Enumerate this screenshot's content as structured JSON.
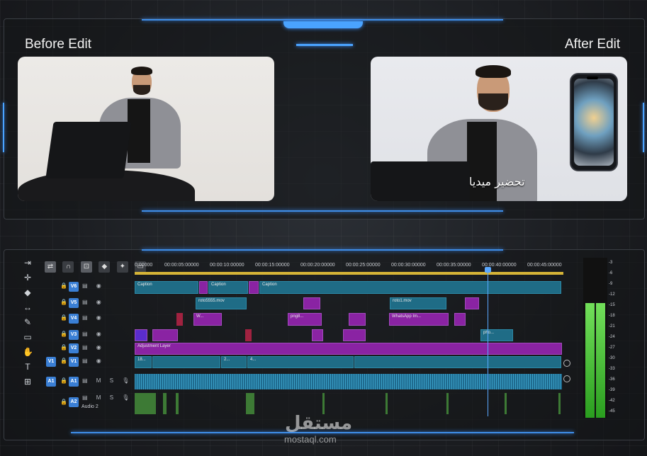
{
  "labels": {
    "before": "Before Edit",
    "after": "After Edit"
  },
  "video_after": {
    "caption": "تحضير ميديا"
  },
  "timeline": {
    "ruler_ticks": [
      "0:00000",
      "00:00:05:00000",
      "00:00:10:00000",
      "00:00:15:00000",
      "00:00:20:00000",
      "00:00:25:00000",
      "00:00:30:00000",
      "00:00:35:00000",
      "00:00:40:00000",
      "00:00:45:00000"
    ],
    "tracks": [
      {
        "id": "V6",
        "clips": [
          "Caption",
          "Caption",
          "Caption"
        ]
      },
      {
        "id": "V5",
        "clips": [
          "roto5555.mov",
          "roto1.mov"
        ]
      },
      {
        "id": "V4",
        "clips": [
          "W...",
          "png8...",
          "WhatsApp Im..."
        ]
      },
      {
        "id": "V3",
        "clips": [
          "pho..."
        ]
      },
      {
        "id": "V2",
        "clips": [
          "Adjustment Layer"
        ]
      },
      {
        "id": "V1",
        "source": "V1",
        "clips": [
          "18...",
          "2...",
          "4..."
        ]
      },
      {
        "id": "A1",
        "source": "A1",
        "labels": [
          "M",
          "S"
        ]
      },
      {
        "id": "A2",
        "name": "Audio 2",
        "labels": [
          "M",
          "S"
        ]
      }
    ],
    "meter_ticks": [
      "-3",
      "-6",
      "-9",
      "-12",
      "-15",
      "-18",
      "-21",
      "-24",
      "-27",
      "-30",
      "-33",
      "-36",
      "-39",
      "-42",
      "-45"
    ]
  },
  "watermark": {
    "arabic": "مستقل",
    "latin": "mostaql.com"
  },
  "colors": {
    "accent": "#4aa3ff",
    "clip_blue": "#1f6c86",
    "clip_purple": "#8a23a3",
    "meter_green": "#4cc83a"
  }
}
